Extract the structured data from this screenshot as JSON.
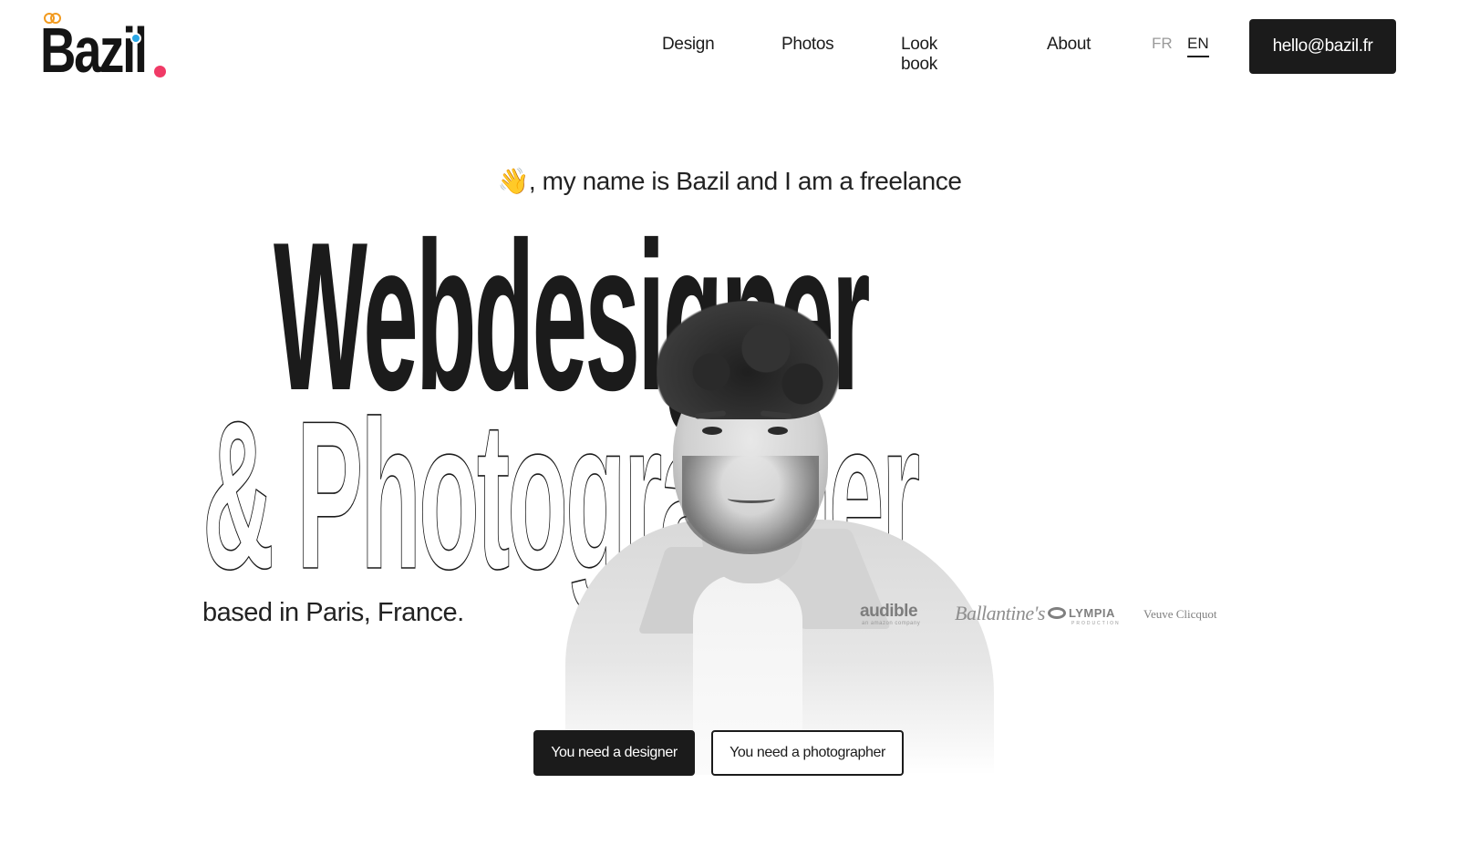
{
  "brand": {
    "name": "Bazil",
    "colors": {
      "rings": "#f29a1f",
      "i_dot": "#2aa7e6",
      "period": "#f03a66",
      "ink": "#1b1b1b"
    }
  },
  "nav": {
    "items": [
      {
        "label": "Design"
      },
      {
        "label": "Photos"
      },
      {
        "label": "Look book"
      },
      {
        "label": "About"
      }
    ]
  },
  "language": {
    "options": [
      {
        "code": "FR",
        "active": false
      },
      {
        "code": "EN",
        "active": true
      }
    ]
  },
  "header": {
    "email_button": "hello@bazil.fr"
  },
  "hero": {
    "wave_icon": "👋",
    "intro": ", my name is Bazil and I am a freelance",
    "title_solid": "Webdesigner",
    "title_outline": "& Photographer",
    "location": "based in Paris, France.",
    "portrait_alt": "portrait-photo"
  },
  "clients": {
    "audible": "audible",
    "audible_sub": "an amazon company",
    "ballantines": "Ballantine's",
    "olympia": "LYMPIA",
    "olympia_sub": "PRODUCTION",
    "veuve": "Veuve Clicquot"
  },
  "cta": {
    "primary": "You need a designer",
    "secondary": "You need a photographer"
  }
}
